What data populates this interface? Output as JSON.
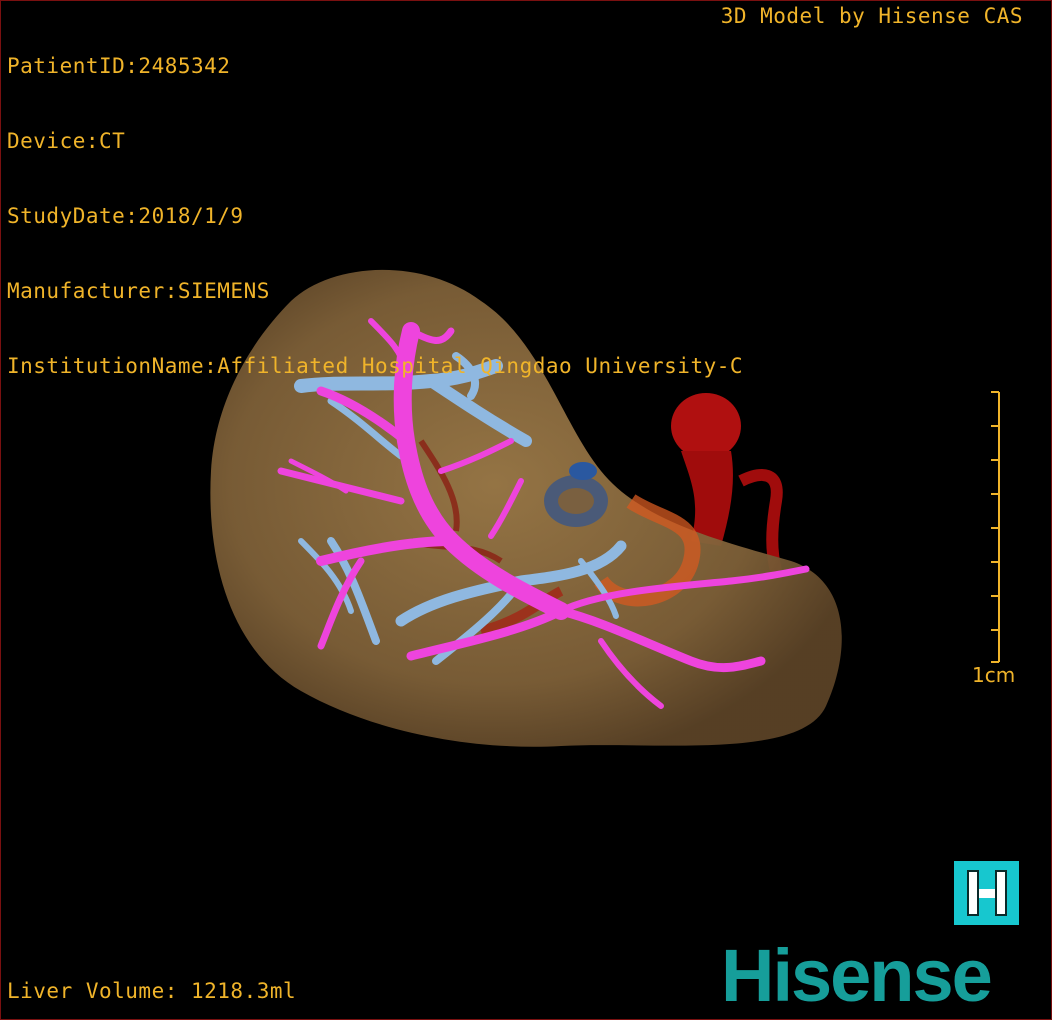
{
  "overlay": {
    "patient_id": "PatientID:2485342",
    "device": "Device:CT",
    "study_date": "StudyDate:2018/1/9",
    "manufacturer": "Manufacturer:SIEMENS",
    "institution": "InstitutionName:Affiliated Hospital Qingdao University-C",
    "credit": "3D Model by Hisense CAS",
    "liver_volume": "Liver Volume: 1218.3ml"
  },
  "scale": {
    "label": "1cm"
  },
  "logo": {
    "wordmark": "Hisense",
    "icon": "hisense-h-icon"
  },
  "colors": {
    "overlay_text": "#f0b42a",
    "liver": "#8a6a3c",
    "portal_vein": "#ee44dd",
    "hepatic_vein": "#8fb8e0",
    "artery": "#c01010",
    "logo_teal": "#169e9a"
  }
}
